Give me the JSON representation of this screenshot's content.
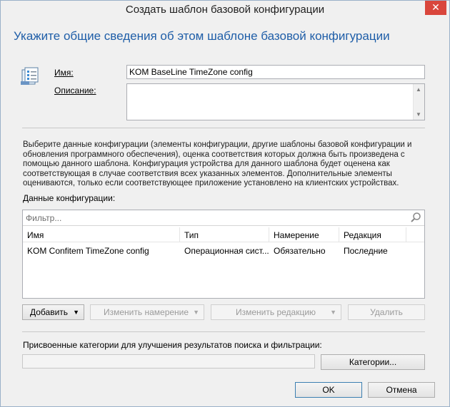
{
  "window": {
    "title": "Создать шаблон базовой конфигурации",
    "close_glyph": "✕"
  },
  "header": "Укажите общие сведения об этом шаблоне базовой конфигурации",
  "form": {
    "name_label": "Имя:",
    "name_value": "KOM BaseLine TimeZone config",
    "description_label": "Описание:",
    "description_value": ""
  },
  "description_text": "Выберите данные конфигурации (элементы конфигурации, другие шаблоны базовой конфигурации и обновления программного обеспечения), оценка соответствия которых должна быть произведена с помощью данного шаблона. Конфигурация устройства для данного шаблона будет оценена как соответствующая в случае соответствия всех указанных элементов. Дополнительные элементы оцениваются, только если соответствующее приложение установлено на клиентских устройствах.",
  "config_data": {
    "label": "Данные конфигурации:",
    "filter_placeholder": "Фильтр...",
    "columns": [
      "Имя",
      "Тип",
      "Намерение",
      "Редакция"
    ],
    "rows": [
      [
        "KOM Confitem TimeZone config",
        "Операционная сист...",
        "Обязательно",
        "Последние"
      ]
    ]
  },
  "buttons": {
    "add": "Добавить",
    "change_intent": "Изменить намерение",
    "change_revision": "Изменить редакцию",
    "delete": "Удалить",
    "categories": "Категории...",
    "ok": "OK",
    "cancel": "Отмена"
  },
  "categories_label": "Присвоенные категории для улучшения результатов поиска и фильтрации:",
  "categories_value": "",
  "icons": {
    "template": "baseline-template-icon",
    "search": "search-icon"
  },
  "colors": {
    "header": "#1f5ea8",
    "close": "#d9463c"
  }
}
